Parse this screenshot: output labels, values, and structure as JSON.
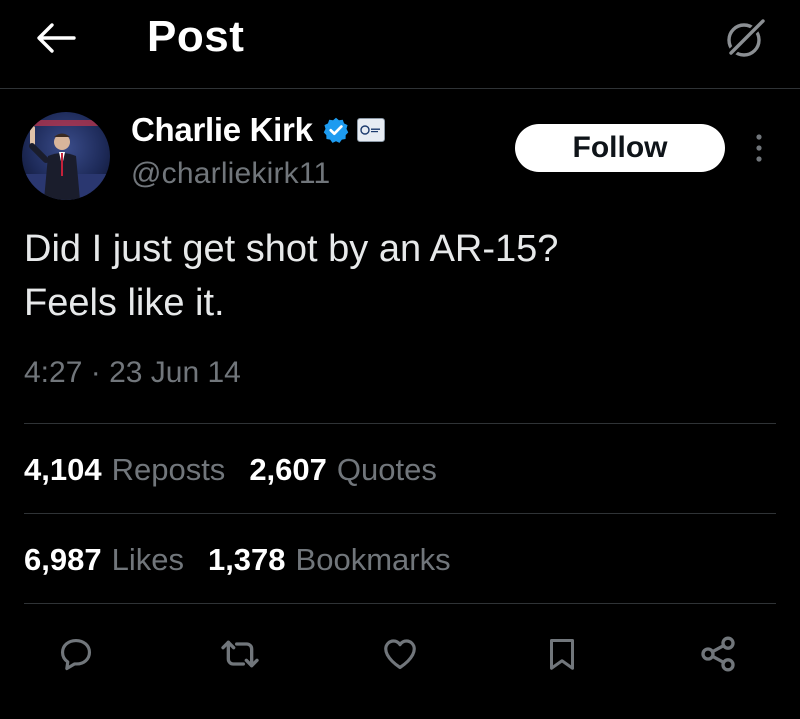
{
  "header": {
    "title": "Post",
    "back_icon": "arrow-left-icon",
    "grok_icon": "grok-icon"
  },
  "author": {
    "display_name": "Charlie Kirk",
    "handle": "@charliekirk11",
    "verified_color": "#1d9bf0"
  },
  "follow_label": "Follow",
  "post": {
    "lines": [
      "Did I just get shot by an AR-15?",
      "Feels like it."
    ],
    "time": "4:27",
    "separator": "·",
    "date": "23 Jun 14"
  },
  "stats": {
    "reposts": {
      "count": "4,104",
      "label": "Reposts"
    },
    "quotes": {
      "count": "2,607",
      "label": "Quotes"
    },
    "likes": {
      "count": "6,987",
      "label": "Likes"
    },
    "bookmarks": {
      "count": "1,378",
      "label": "Bookmarks"
    }
  },
  "actions": [
    "reply-icon",
    "repost-icon",
    "like-icon",
    "bookmark-icon",
    "share-icon"
  ],
  "colors": {
    "background": "#000000",
    "text": "#e7e9ea",
    "muted": "#71767b",
    "divider": "#2f3336",
    "accent": "#1d9bf0"
  }
}
